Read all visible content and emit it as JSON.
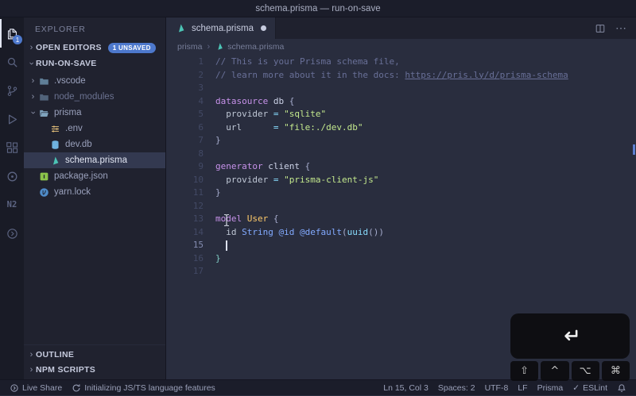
{
  "window": {
    "title": "schema.prisma — run-on-save"
  },
  "activity_bar": {
    "items": [
      {
        "name": "explorer",
        "active": true,
        "badge": "1"
      },
      {
        "name": "search"
      },
      {
        "name": "source-control"
      },
      {
        "name": "run-debug"
      },
      {
        "name": "extensions"
      },
      {
        "name": "circle-extension"
      },
      {
        "name": "n2-extension",
        "glyph": "N2"
      },
      {
        "name": "live-share"
      }
    ]
  },
  "sidebar": {
    "title": "EXPLORER",
    "open_editors": {
      "label": "OPEN EDITORS",
      "badge": "1 UNSAVED"
    },
    "workspace": {
      "label": "RUN-ON-SAVE"
    },
    "tree": [
      {
        "label": ".vscode",
        "kind": "folder",
        "collapsed": true,
        "indent": 0,
        "icon_color": "#5f7e97"
      },
      {
        "label": "node_modules",
        "kind": "folder",
        "collapsed": true,
        "indent": 0,
        "icon_color": "#51637a",
        "dim": true
      },
      {
        "label": "prisma",
        "kind": "folder",
        "collapsed": false,
        "indent": 0,
        "icon_color": "#7fa3bd"
      },
      {
        "label": ".env",
        "kind": "file",
        "icon": "env",
        "indent": 1,
        "icon_color": "#e5c07b"
      },
      {
        "label": "dev.db",
        "kind": "file",
        "icon": "db",
        "indent": 1,
        "icon_color": "#6fb3e0"
      },
      {
        "label": "schema.prisma",
        "kind": "file",
        "icon": "prisma",
        "indent": 1,
        "icon_color": "#4cc4b5",
        "selected": true
      },
      {
        "label": "package.json",
        "kind": "file",
        "icon": "npm",
        "indent": 0,
        "icon_color": "#8bc34a"
      },
      {
        "label": "yarn.lock",
        "kind": "file",
        "icon": "yarn",
        "indent": 0,
        "icon_color": "#4f8cc9"
      }
    ],
    "bottom_sections": [
      {
        "label": "OUTLINE"
      },
      {
        "label": "NPM SCRIPTS"
      }
    ]
  },
  "editor": {
    "tab": {
      "label": "schema.prisma",
      "modified": true
    },
    "breadcrumb": {
      "folder": "prisma",
      "file": "schema.prisma"
    },
    "cursor_line": 15,
    "lines": [
      {
        "n": 1,
        "tokens": [
          {
            "t": "// This is your Prisma schema file,",
            "c": "comment"
          }
        ]
      },
      {
        "n": 2,
        "tokens": [
          {
            "t": "// learn more about it in the docs: ",
            "c": "comment"
          },
          {
            "t": "https://pris.ly/d/prisma-schema",
            "c": "link"
          }
        ]
      },
      {
        "n": 3,
        "tokens": []
      },
      {
        "n": 4,
        "tokens": [
          {
            "t": "datasource",
            "c": "kw"
          },
          {
            "t": " ",
            "c": "punct"
          },
          {
            "t": "db",
            "c": "ident"
          },
          {
            "t": " {",
            "c": "punct"
          }
        ]
      },
      {
        "n": 5,
        "tokens": [
          {
            "t": "  provider ",
            "c": "prop"
          },
          {
            "t": "=",
            "c": "op"
          },
          {
            "t": " ",
            "c": "punct"
          },
          {
            "t": "\"sqlite\"",
            "c": "str"
          }
        ]
      },
      {
        "n": 6,
        "tokens": [
          {
            "t": "  url      ",
            "c": "prop"
          },
          {
            "t": "=",
            "c": "op"
          },
          {
            "t": " ",
            "c": "punct"
          },
          {
            "t": "\"file:./dev.db\"",
            "c": "str"
          }
        ]
      },
      {
        "n": 7,
        "tokens": [
          {
            "t": "}",
            "c": "punct"
          }
        ]
      },
      {
        "n": 8,
        "tokens": []
      },
      {
        "n": 9,
        "tokens": [
          {
            "t": "generator",
            "c": "kw"
          },
          {
            "t": " ",
            "c": "punct"
          },
          {
            "t": "client",
            "c": "ident"
          },
          {
            "t": " {",
            "c": "punct"
          }
        ]
      },
      {
        "n": 10,
        "tokens": [
          {
            "t": "  provider ",
            "c": "prop"
          },
          {
            "t": "=",
            "c": "op"
          },
          {
            "t": " ",
            "c": "punct"
          },
          {
            "t": "\"prisma-client-js\"",
            "c": "str"
          }
        ]
      },
      {
        "n": 11,
        "tokens": [
          {
            "t": "}",
            "c": "punct"
          }
        ]
      },
      {
        "n": 12,
        "tokens": []
      },
      {
        "n": 13,
        "tokens": [
          {
            "t": "model",
            "c": "kw"
          },
          {
            "t": " ",
            "c": "punct"
          },
          {
            "t": "User",
            "c": "type"
          },
          {
            "t": " {",
            "c": "punct"
          }
        ]
      },
      {
        "n": 14,
        "tokens": [
          {
            "t": "  id ",
            "c": "prop"
          },
          {
            "t": "String",
            "c": "blue"
          },
          {
            "t": " ",
            "c": "punct"
          },
          {
            "t": "@id",
            "c": "blue"
          },
          {
            "t": " ",
            "c": "punct"
          },
          {
            "t": "@default",
            "c": "blue"
          },
          {
            "t": "(",
            "c": "punct"
          },
          {
            "t": "uuid",
            "c": "cyan"
          },
          {
            "t": "())",
            "c": "punct"
          }
        ]
      },
      {
        "n": 15,
        "tokens": [
          {
            "t": "  ",
            "c": "punct"
          }
        ],
        "cursor": true
      },
      {
        "n": 16,
        "tokens": [
          {
            "t": "}",
            "c": "teal"
          }
        ]
      },
      {
        "n": 17,
        "tokens": []
      }
    ]
  },
  "status_bar": {
    "left": [
      {
        "icon": "live-share",
        "label": "Live Share"
      },
      {
        "icon": "sync",
        "label": "Initializing JS/TS language features"
      }
    ],
    "right": [
      {
        "label": "Ln 15, Col 3"
      },
      {
        "label": "Spaces: 2"
      },
      {
        "label": "UTF-8"
      },
      {
        "label": "LF"
      },
      {
        "label": "Prisma"
      },
      {
        "icon": "check",
        "label": "ESLint"
      },
      {
        "icon": "bell",
        "label": ""
      }
    ]
  },
  "keycast": {
    "key_name": "return",
    "key_symbol": "↵",
    "modifiers": [
      "⇧",
      "^",
      "⌥",
      "⌘"
    ]
  },
  "colors": {
    "accent": "#4d78cc",
    "prisma_teal": "#4cc4b5",
    "string_green": "#c3e88d",
    "keyword_purple": "#c792ea"
  }
}
